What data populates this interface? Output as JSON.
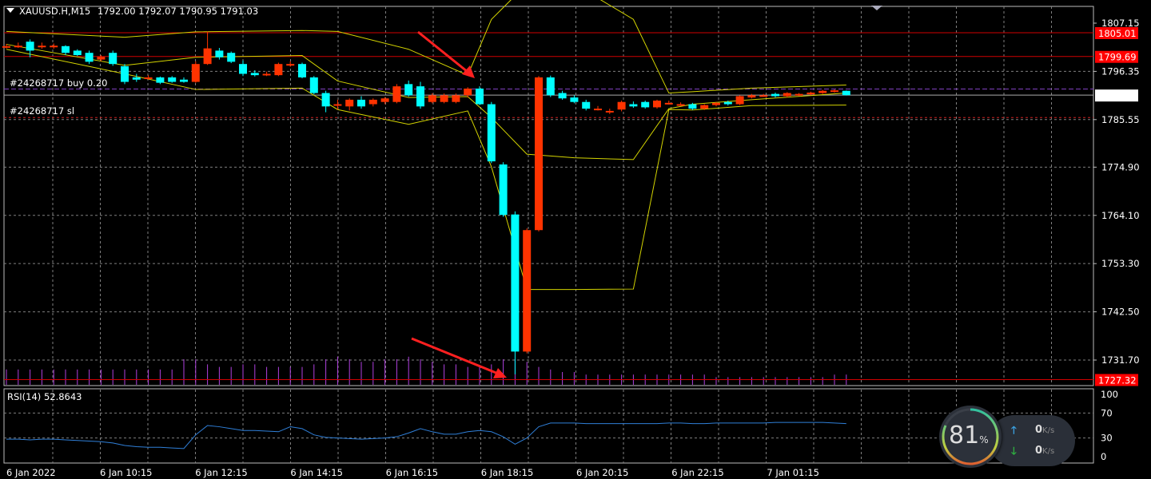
{
  "header": {
    "symbol": "XAUUSD.H,M15",
    "ohlc": "1792.00 1792.07 1790.95 1791.03"
  },
  "orders": {
    "buy_label": "#24268717 buy 0.20",
    "sl_label": "#24268717 sl",
    "buy_price": 1792.4,
    "sl_price": 1786.0
  },
  "price_axis": [
    "1807.15",
    "1796.35",
    "1785.55",
    "1774.90",
    "1764.10",
    "1753.30",
    "1742.50",
    "1731.70"
  ],
  "price_badges": [
    {
      "label": "1805.01",
      "value": 1805.01,
      "bg": "#ff0000"
    },
    {
      "label": "1799.69",
      "value": 1799.69,
      "bg": "#ff0000"
    },
    {
      "label": "1791.03",
      "value": 1791.03,
      "bg": "#ffffff"
    },
    {
      "label": "1727.32",
      "value": 1727.32,
      "bg": "#ff0000"
    }
  ],
  "time_axis": [
    "6 Jan 2022",
    "6 Jan 10:15",
    "6 Jan 12:15",
    "6 Jan 14:15",
    "6 Jan 16:15",
    "6 Jan 18:15",
    "6 Jan 20:15",
    "6 Jan 22:15",
    "7 Jan 01:15"
  ],
  "rsi": {
    "label": "RSI(14) 52.8643",
    "levels": [
      "100",
      "70",
      "30",
      "0"
    ],
    "values": [
      28,
      28,
      27,
      28,
      28,
      27,
      26,
      25,
      24,
      22,
      18,
      16,
      15,
      15,
      14,
      13,
      35,
      50,
      48,
      45,
      42,
      42,
      41,
      40,
      48,
      45,
      35,
      31,
      30,
      29,
      28,
      29,
      30,
      32,
      38,
      45,
      40,
      36,
      36,
      40,
      42,
      40,
      32,
      20,
      30,
      48,
      54,
      54,
      54,
      53,
      53,
      53,
      53,
      53,
      53,
      53,
      54,
      54,
      53,
      53,
      54,
      54,
      54,
      54,
      54,
      55,
      55,
      55,
      55,
      55,
      54,
      53
    ]
  },
  "colors": {
    "bull": "#00ffff",
    "bear": "#ff3300",
    "band": "#d4d400",
    "grid": "#7f7f7f",
    "volume": "#b040e0",
    "rsi": "#2f7fd8"
  },
  "chart_data": {
    "type": "candlestick",
    "timeframe": "M15",
    "ohlc": [
      [
        1802,
        1802.5,
        1801.5,
        1802
      ],
      [
        1802,
        1802.8,
        1801.6,
        1802.1
      ],
      [
        1803,
        1803.5,
        1799.5,
        1801
      ],
      [
        1802,
        1802.8,
        1801.4,
        1802.1
      ],
      [
        1802,
        1802.6,
        1801.4,
        1802.1
      ],
      [
        1802,
        1802.2,
        1800,
        1800.5
      ],
      [
        1801,
        1801.3,
        1799.8,
        1800
      ],
      [
        1800.5,
        1801,
        1798,
        1798.5
      ],
      [
        1799,
        1800,
        1798.6,
        1799.6
      ],
      [
        1800.5,
        1801,
        1797.6,
        1798
      ],
      [
        1797.5,
        1798,
        1793.5,
        1794
      ],
      [
        1795,
        1795.8,
        1794,
        1794.5
      ],
      [
        1794.8,
        1795.5,
        1794.5,
        1795
      ],
      [
        1795,
        1795.2,
        1793.5,
        1793.8
      ],
      [
        1795,
        1795.3,
        1793.8,
        1794
      ],
      [
        1794.5,
        1795,
        1793.8,
        1794
      ],
      [
        1794,
        1798.6,
        1793.8,
        1798
      ],
      [
        1798,
        1805.3,
        1797.8,
        1801.5
      ],
      [
        1801,
        1801.6,
        1799,
        1799.5
      ],
      [
        1800.5,
        1800.8,
        1798.2,
        1798.5
      ],
      [
        1798,
        1798.8,
        1795.3,
        1795.8
      ],
      [
        1796,
        1796.6,
        1795.2,
        1795.5
      ],
      [
        1795.8,
        1796.3,
        1795.3,
        1795.8
      ],
      [
        1795.5,
        1798.3,
        1795.3,
        1798
      ],
      [
        1798,
        1798.6,
        1797.4,
        1798
      ],
      [
        1798,
        1798.3,
        1794.8,
        1795
      ],
      [
        1795,
        1795.3,
        1791.2,
        1791.5
      ],
      [
        1791.5,
        1792,
        1787.2,
        1788.5
      ],
      [
        1789,
        1790,
        1787.8,
        1789
      ],
      [
        1788.5,
        1790.3,
        1787.6,
        1790
      ],
      [
        1790,
        1790.8,
        1788,
        1788.5
      ],
      [
        1789,
        1790.3,
        1788.5,
        1790
      ],
      [
        1789.5,
        1790.6,
        1789,
        1790.3
      ],
      [
        1789.5,
        1793.5,
        1789.2,
        1793
      ],
      [
        1793.5,
        1794.3,
        1790.7,
        1791
      ],
      [
        1793,
        1794,
        1788,
        1788.5
      ],
      [
        1789.5,
        1791.4,
        1789.2,
        1791
      ],
      [
        1789.5,
        1791.4,
        1789.2,
        1791
      ],
      [
        1789.5,
        1791.4,
        1789.2,
        1791
      ],
      [
        1791,
        1792.8,
        1790.5,
        1792.5
      ],
      [
        1792.5,
        1793,
        1788.8,
        1789
      ],
      [
        1789,
        1789.5,
        1775.8,
        1776.2
      ],
      [
        1775.5,
        1776,
        1763.8,
        1764.2
      ],
      [
        1764.3,
        1765,
        1728.5,
        1733.6
      ],
      [
        1733.6,
        1761.2,
        1733.2,
        1760.8
      ],
      [
        1760.8,
        1795.3,
        1760.5,
        1795
      ],
      [
        1795,
        1795.4,
        1790.6,
        1791
      ],
      [
        1791.5,
        1792,
        1790,
        1790.3
      ],
      [
        1790.5,
        1791,
        1789.2,
        1789.5
      ],
      [
        1789.5,
        1790,
        1787.6,
        1788
      ],
      [
        1788,
        1788.6,
        1787.6,
        1788
      ],
      [
        1787.5,
        1788,
        1786.8,
        1787.5
      ],
      [
        1787.8,
        1789.8,
        1787.4,
        1789.5
      ],
      [
        1789,
        1789.6,
        1788.2,
        1788.5
      ],
      [
        1789.5,
        1789.8,
        1788,
        1788.3
      ],
      [
        1788.3,
        1790,
        1788,
        1789.8
      ],
      [
        1789.3,
        1789.8,
        1788.9,
        1789.3
      ],
      [
        1789,
        1789.4,
        1788.6,
        1789
      ],
      [
        1789,
        1789.3,
        1787.7,
        1788
      ],
      [
        1788,
        1789,
        1787.7,
        1788.8
      ],
      [
        1788.8,
        1789.5,
        1788.5,
        1789.3
      ],
      [
        1789.5,
        1789.8,
        1788.7,
        1789
      ],
      [
        1789,
        1791,
        1788.8,
        1790.8
      ],
      [
        1790.5,
        1791.3,
        1790.3,
        1791
      ],
      [
        1791,
        1791.3,
        1790.7,
        1791
      ],
      [
        1791.3,
        1791.6,
        1790.5,
        1790.8
      ],
      [
        1790.8,
        1791.7,
        1790.5,
        1791.5
      ],
      [
        1791,
        1791.5,
        1790.8,
        1791.3
      ],
      [
        1791.2,
        1791.8,
        1791,
        1791.6
      ],
      [
        1791.5,
        1792.2,
        1791.3,
        1792
      ],
      [
        1791.8,
        1792.3,
        1791.6,
        1792.1
      ],
      [
        1792,
        1792.07,
        1790.95,
        1791.03
      ]
    ],
    "bands": {
      "index": [
        0,
        10,
        16,
        25,
        28,
        34,
        39,
        41,
        44,
        48,
        53,
        56,
        58,
        63,
        71
      ],
      "upper": [
        1805.3,
        1804,
        1805.2,
        1805.5,
        1805.3,
        1801.3,
        1795.5,
        1808,
        1820,
        1820,
        1808,
        1791.5,
        1791.8,
        1792.6,
        1793.3
      ],
      "middle": [
        1802.4,
        1797.7,
        1799.5,
        1799.9,
        1794.2,
        1790.5,
        1790.7,
        1786,
        1777.8,
        1777,
        1776.6,
        1788,
        1789,
        1790,
        1791.5
      ],
      "lower": [
        1801.3,
        1795.8,
        1792.3,
        1792.6,
        1787.8,
        1784.5,
        1787.5,
        1775,
        1747.5,
        1747.5,
        1747.6,
        1787.8,
        1787.7,
        1788.7,
        1788.8
      ]
    },
    "volume": [
      6,
      6,
      6,
      6,
      6,
      6,
      6,
      6,
      6,
      6,
      6,
      6,
      6,
      6,
      6,
      10,
      10,
      8,
      7,
      7,
      8,
      8,
      7,
      7,
      7,
      7,
      8,
      10,
      11,
      10,
      9,
      9,
      10,
      10,
      11,
      10,
      9,
      8,
      8,
      7,
      7,
      8,
      10,
      10,
      9,
      7,
      6,
      5,
      5,
      4,
      4,
      4,
      4,
      4,
      4,
      4,
      4,
      4,
      4,
      4,
      3,
      3,
      3,
      3,
      3,
      3,
      3,
      3,
      3,
      3,
      4,
      4
    ],
    "ylim": [
      1727.32,
      1810.9
    ]
  },
  "system_widget": {
    "cpu_percent": "81",
    "percent_sign": "%",
    "upload": "0",
    "download": "0",
    "unit": "K/s"
  }
}
